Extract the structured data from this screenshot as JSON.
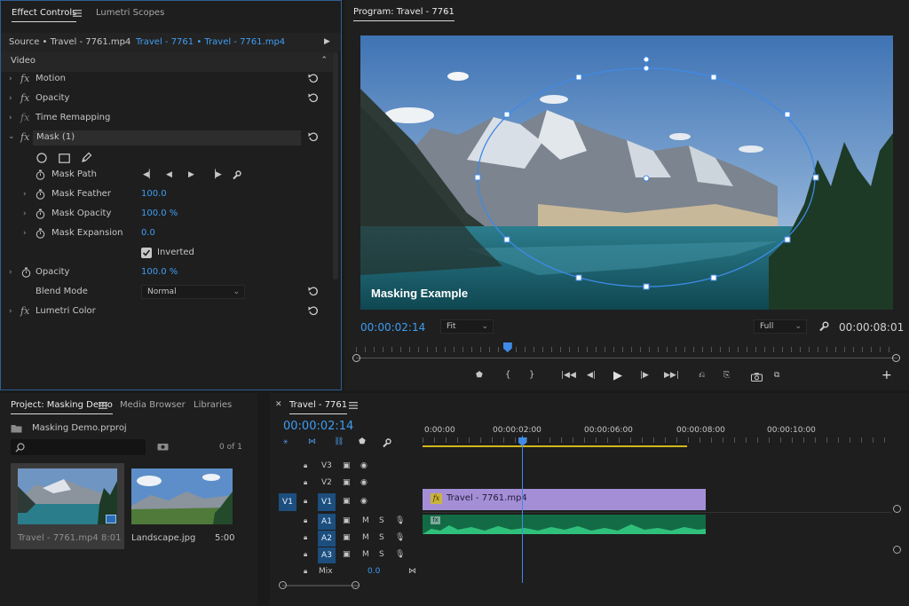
{
  "effect_controls": {
    "tabs": [
      {
        "label": "Effect Controls"
      },
      {
        "label": "Lumetri Scopes"
      }
    ],
    "source_label": "Source • Travel - 7761.mp4",
    "sequence_label": "Travel - 7761 • Travel - 7761.mp4",
    "section": "Video",
    "effects": {
      "motion": "Motion",
      "opacity": "Opacity",
      "time_remapping": "Time Remapping",
      "mask": "Mask (1)",
      "mask_path": "Mask Path",
      "mask_feather": {
        "label": "Mask Feather",
        "value": "100.0"
      },
      "mask_opacity": {
        "label": "Mask Opacity",
        "value": "100.0 %"
      },
      "mask_expansion": {
        "label": "Mask Expansion",
        "value": "0.0"
      },
      "inverted": {
        "label": "Inverted",
        "checked": true
      },
      "opacity_param": {
        "label": "Opacity",
        "value": "100.0 %"
      },
      "blend_mode": {
        "label": "Blend Mode",
        "value": "Normal"
      },
      "lumetri_color": "Lumetri Color"
    }
  },
  "program_monitor": {
    "title": "Program: Travel - 7761",
    "overlay_title": "Masking Example",
    "current_timecode": "00:00:02:14",
    "fit": "Fit",
    "quality": "Full",
    "duration": "00:00:08:01",
    "playhead_fraction": 0.28
  },
  "project": {
    "tabs": [
      {
        "label": "Project: Masking Demo"
      },
      {
        "label": "Media Browser"
      },
      {
        "label": "Libraries"
      }
    ],
    "file": "Masking Demo.prproj",
    "count": "0 of 1",
    "items": [
      {
        "name": "Travel - 7761.mp4",
        "duration": "8:01"
      },
      {
        "name": "Landscape.jpg",
        "duration": "5:00"
      }
    ]
  },
  "timeline": {
    "title": "Travel - 7761",
    "timecode": "00:00:02:14",
    "ruler": [
      "0:00:00",
      "00:00:02:00",
      "00:00:06:00",
      "00:00:08:00",
      "00:00:10:00"
    ],
    "tracks": {
      "v3": "V3",
      "v2": "V2",
      "v1": "V1",
      "src_v1": "V1",
      "a1": "A1",
      "a2": "A2",
      "a3": "A3",
      "mix": "Mix",
      "mix_value": "0.0",
      "m": "M",
      "s": "S"
    },
    "clip_label": "Travel - 7761.mp4"
  },
  "colors": {
    "accent": "#3f9df3",
    "clip_video": "#a48fd6",
    "clip_audio": "#1c8a5c",
    "work_area": "#d2b71c"
  },
  "icons": [
    "hamburger-icon",
    "reset-icon",
    "ellipse-mask-icon",
    "rectangle-mask-icon",
    "pen-icon",
    "stopwatch-icon",
    "wrench-icon",
    "play-icon",
    "camera-icon",
    "eye-icon",
    "lock-icon",
    "mic-icon",
    "plus-icon",
    "folder-icon",
    "search-icon"
  ]
}
